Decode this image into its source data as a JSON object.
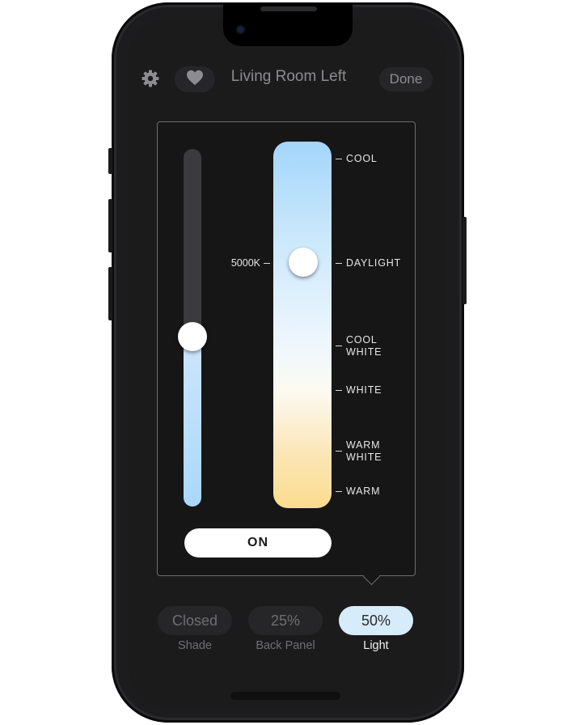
{
  "header": {
    "title": "Living Room Left",
    "done_label": "Done"
  },
  "light_panel": {
    "brightness_level": 0.5,
    "color_temp_value": "5000K",
    "color_temp_level": 0.67,
    "scale_labels": [
      "COOL",
      "DAYLIGHT",
      "COOL\nWHITE",
      "WHITE",
      "WARM\nWHITE",
      "WARM"
    ],
    "on_button_label": "ON"
  },
  "devices": [
    {
      "value": "Closed",
      "label": "Shade",
      "selected": false
    },
    {
      "value": "25%",
      "label": "Back Panel",
      "selected": false
    },
    {
      "value": "50%",
      "label": "Light",
      "selected": true
    }
  ],
  "colors": {
    "selected_pill": "#d6ecfb",
    "dark_pill": "#262628",
    "muted_text": "#8d8d91"
  }
}
